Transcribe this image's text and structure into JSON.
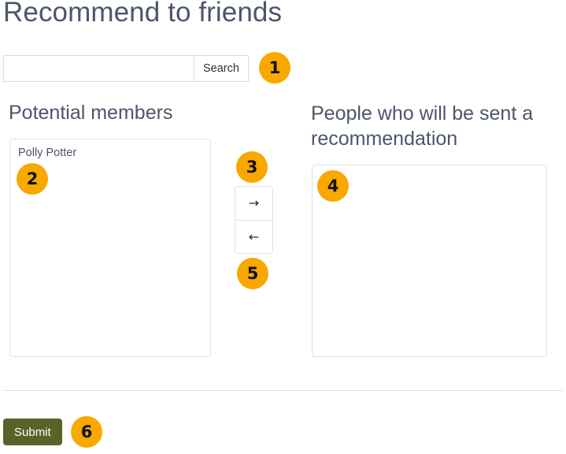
{
  "page": {
    "title": "Recommend to friends"
  },
  "search": {
    "value": "",
    "placeholder": "",
    "button_label": "Search"
  },
  "columns": {
    "left": {
      "heading": "Potential members",
      "options": [
        "Polly Potter"
      ]
    },
    "right": {
      "heading": "People who will be sent a recommendation",
      "options": []
    }
  },
  "transfer_controls": {
    "add_label": "→",
    "add_icon": "arrow-right-icon",
    "remove_label": "←",
    "remove_icon": "arrow-left-icon"
  },
  "footer": {
    "submit_label": "Submit"
  },
  "annotations": [
    {
      "id": "1",
      "label": "1"
    },
    {
      "id": "2",
      "label": "2"
    },
    {
      "id": "3",
      "label": "3"
    },
    {
      "id": "4",
      "label": "4"
    },
    {
      "id": "5",
      "label": "5"
    },
    {
      "id": "6",
      "label": "6"
    }
  ],
  "colors": {
    "badge_background": "#f9a800",
    "badge_text": "#111111",
    "submit_background": "#5b6228",
    "heading_text": "#4c566a",
    "border": "#e0e0e0"
  }
}
